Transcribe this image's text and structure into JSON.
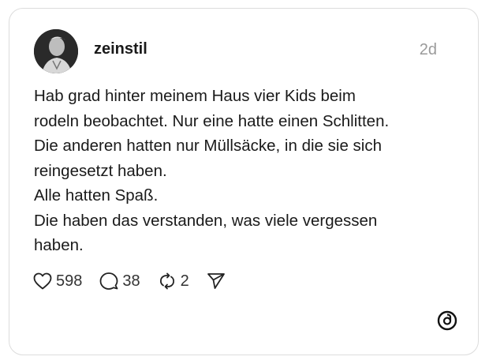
{
  "post": {
    "username": "zeinstil",
    "timestamp": "2d",
    "lines": [
      "Hab grad hinter meinem Haus vier Kids beim",
      "rodeln beobachtet. Nur eine hatte einen Schlitten.",
      "Die anderen hatten nur Müllsäcke, in die sie sich",
      "reingesetzt haben.",
      "Alle hatten Spaß.",
      "Die haben das verstanden, was viele vergessen",
      "haben."
    ]
  },
  "actions": {
    "likes": "598",
    "replies": "38",
    "reposts": "2"
  },
  "icons": {
    "like": "heart-icon",
    "reply": "speech-bubble-icon",
    "repost": "repost-arrows-icon",
    "share": "send-icon",
    "brand": "threads-logo-icon"
  }
}
